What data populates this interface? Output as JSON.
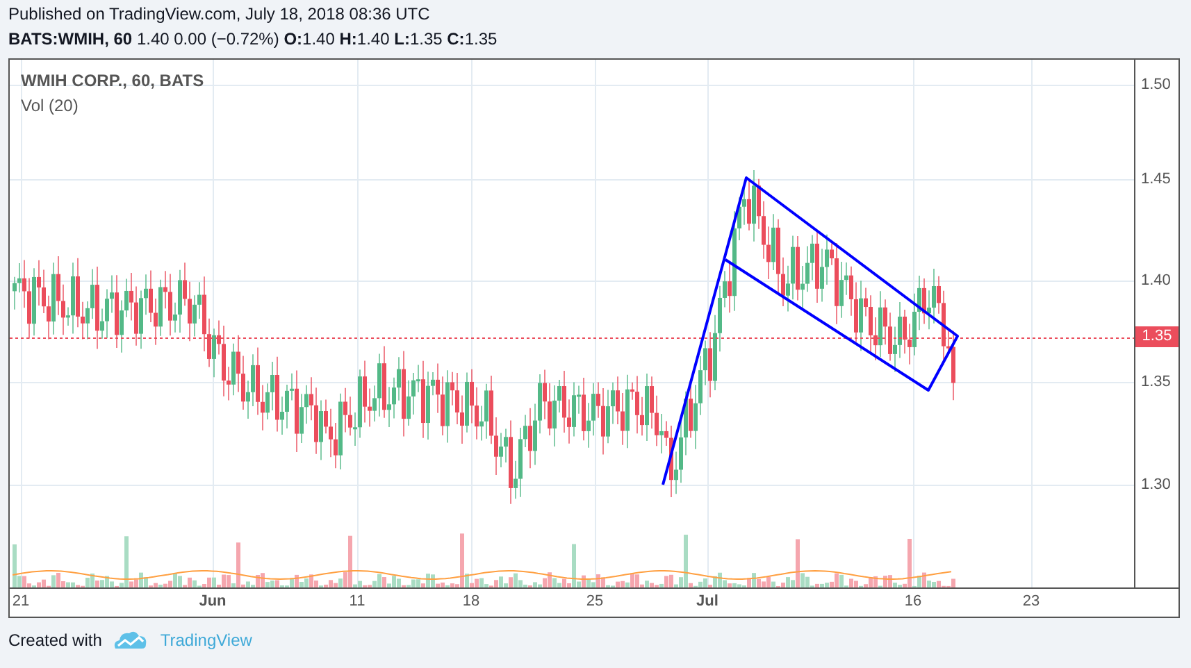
{
  "header": {
    "published": "Published on TradingView.com, July 18, 2018 08:36 UTC",
    "quote": "**BATS:WMIH, 60** 1.40 0.00 (−0.72%) **O:**1.40 **H:**1.40 **L:**1.35 **C:**1.35"
  },
  "chart": {
    "legend_title": "WMIH CORP., 60, BATS",
    "volume_label": "Vol (20)",
    "price_ticks": [
      "1.50",
      "1.45",
      "1.40",
      "1.35",
      "1.30"
    ],
    "last_price": "1.35",
    "time_ticks": [
      {
        "label": "21",
        "kind": "day"
      },
      {
        "label": "Jun",
        "kind": "month"
      },
      {
        "label": "11",
        "kind": "day"
      },
      {
        "label": "18",
        "kind": "day"
      },
      {
        "label": "25",
        "kind": "day"
      },
      {
        "label": "Jul",
        "kind": "month"
      },
      {
        "label": "16",
        "kind": "day"
      },
      {
        "label": "23",
        "kind": "day"
      }
    ]
  },
  "footer": {
    "text": "Created with",
    "brand": "TradingView"
  }
}
